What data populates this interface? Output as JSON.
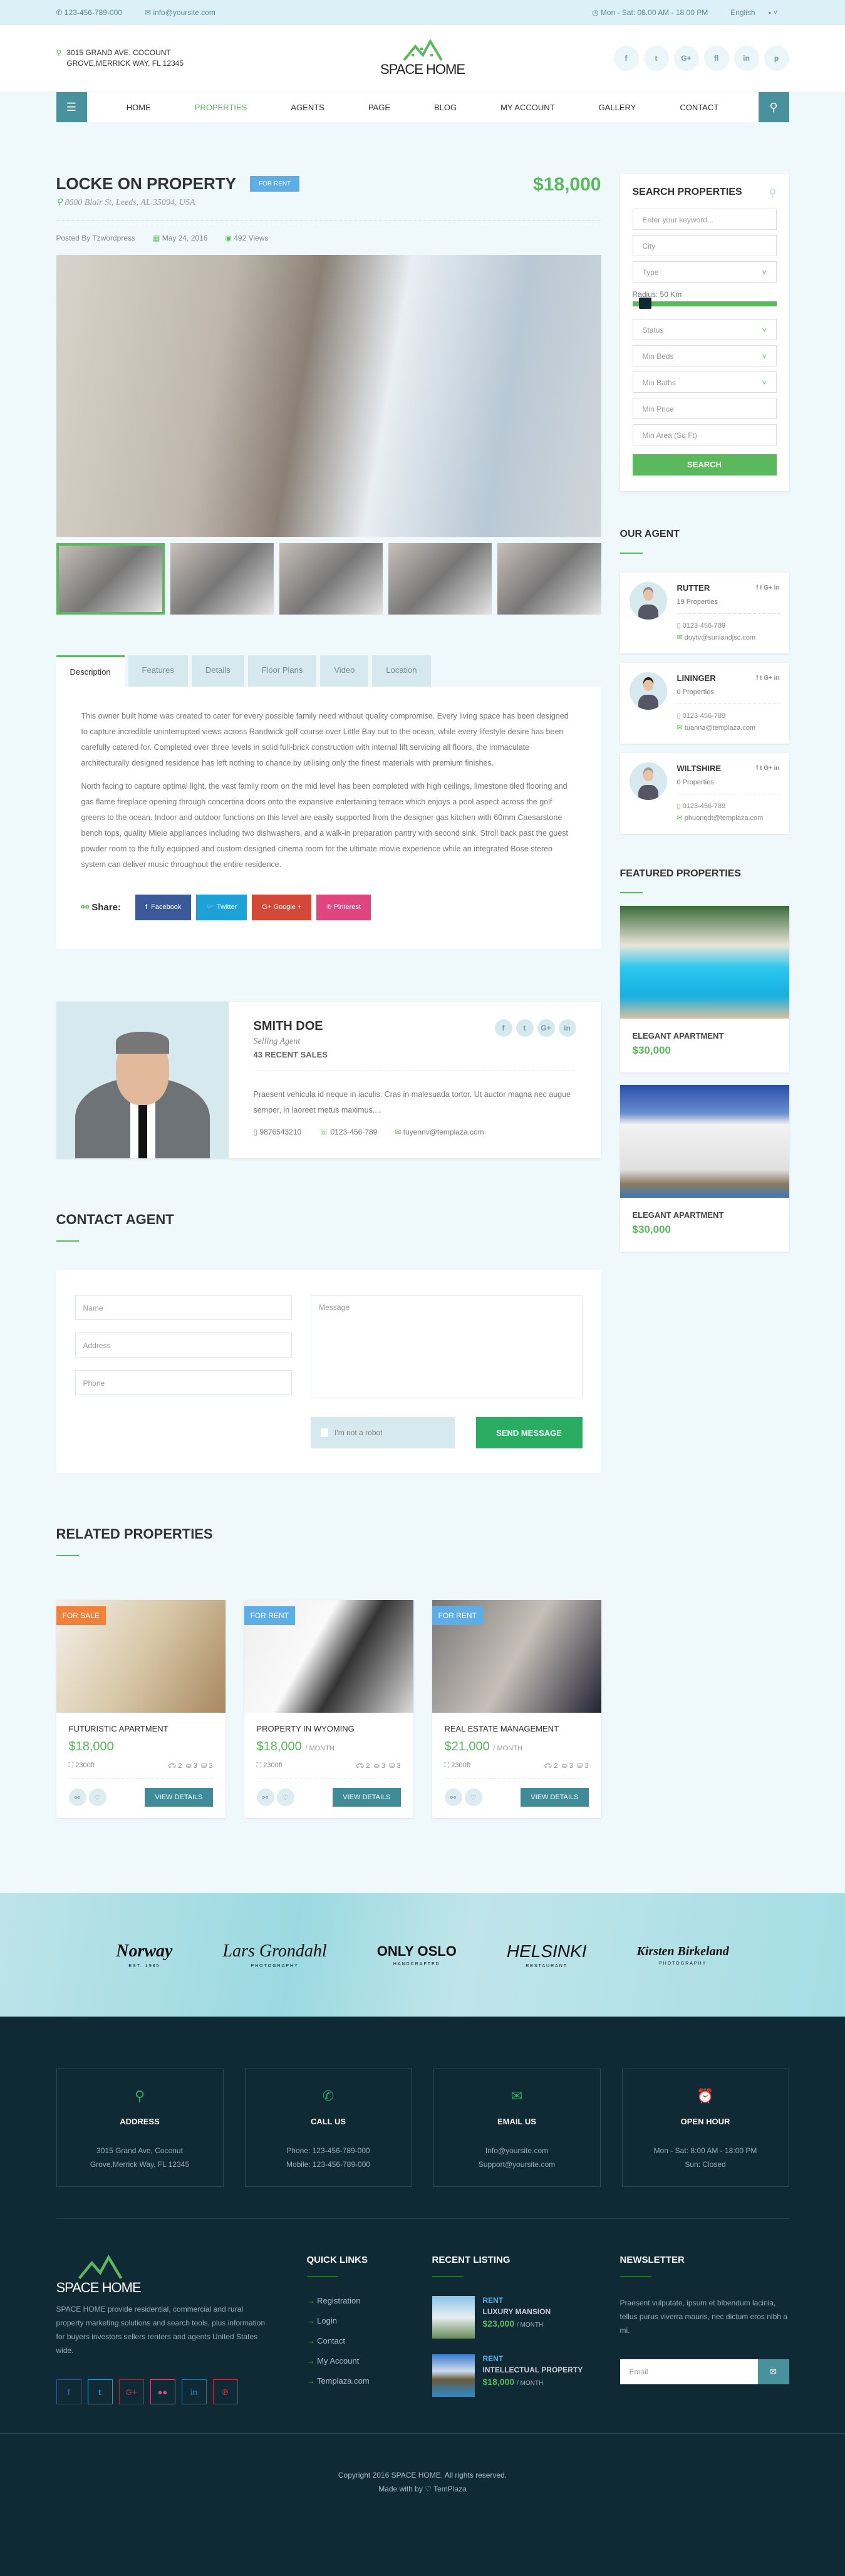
{
  "topbar": {
    "phone": "123-456-789-000",
    "email": "info@yoursite.com",
    "hours": "Mon - Sat: 08.00 AM - 18.00 PM",
    "language": "English"
  },
  "header": {
    "address_line1": "3015 GRAND AVE, COCOUNT",
    "address_line2": "GROVE,MERRICK WAY, FL 12345",
    "logo": "SPACE HOME",
    "socials": [
      "f",
      "t",
      "G+",
      "fl",
      "in",
      "p"
    ]
  },
  "nav": {
    "items": [
      "HOME",
      "PROPERTIES",
      "AGENTS",
      "PAGE",
      "BLOG",
      "MY ACCOUNT",
      "GALLERY",
      "CONTACT"
    ],
    "active": "PROPERTIES"
  },
  "property": {
    "title": "LOCKE ON PROPERTY",
    "badge": "FOR RENT",
    "price": "$18,000",
    "address": "8600 Blair St, Leeds, AL 35094, USA",
    "posted_by": "Posted By Tzwordpress",
    "date": "May 24, 2016",
    "views": "492 Views"
  },
  "tabs": [
    "Description",
    "Features",
    "Details",
    "Floor Plans",
    "Video",
    "Location"
  ],
  "description": [
    "This owner built home was created to cater for every possible family need without quality compromise. Every living space has been designed to capture incredible uninterrupted views across Randwick golf course over Little Bay out to the ocean, while every lifestyle desire has been carefully catered for. Completed over three levels in solid full-brick construction with internal lift servicing all floors, the immaculate architecturally designed residence has left nothing to chance by utilising only the finest materials with premium finishes.",
    "North facing to capture optimal light, the vast family room on the mid level has been completed with high ceilings, limestone tiled flooring and gas flame fireplace opening through concertina doors onto the expansive entertaining terrace which enjoys a pool aspect across the golf greens to the ocean. Indoor and outdoor functions on this level are easily supported from the designer gas kitchen with 60mm Caesarstone bench tops, quality Miele appliances including two dishwashers, and a walk-in preparation pantry with second sink. Stroll back past the guest powder room to the fully equipped and custom designed cinema room for the ultimate movie experience while an integrated Bose stereo system can deliver music throughout the entire residence."
  ],
  "share": {
    "label": "Share:",
    "buttons": [
      {
        "label": "Facebook",
        "color": "#3b5998"
      },
      {
        "label": "Twitter",
        "color": "#1da1d6"
      },
      {
        "label": "Google +",
        "color": "#d34836"
      },
      {
        "label": "Pinterest",
        "color": "#e1457f"
      }
    ]
  },
  "agent": {
    "name": "SMITH DOE",
    "role": "Selling Agent",
    "sales": "43 RECENT SALES",
    "bio": "Praesent vehicula id neque in iaculis. Cras in malesuada tortor. Ut auctor magna nec augue semper, in laoreet metus maximus....",
    "mobile": "9876543210",
    "phone": "0123-456-789",
    "email": "tuyennv@templaza.com",
    "socials": [
      "f",
      "t",
      "G+",
      "in"
    ]
  },
  "contact": {
    "title": "CONTACT AGENT",
    "name": "Name",
    "address": "Address",
    "phone": "Phone",
    "message": "Message",
    "robot": "I'm not a robot",
    "send": "SEND MESSAGE"
  },
  "related": {
    "title": "RELATED PROPERTIES",
    "items": [
      {
        "badge": "FOR SALE",
        "badge_color": "#f0813a",
        "title": "FUTURISTIC APARTMENT",
        "price": "$18,000",
        "period": "",
        "area": "2300ft",
        "garage": "2",
        "bath": "3",
        "bed": "3",
        "button": "VIEW DETAILS"
      },
      {
        "badge": "FOR RENT",
        "badge_color": "#5daee6",
        "title": "PROPERTY IN WYOMING",
        "price": "$18,000",
        "period": "/ MONTH",
        "area": "2300ft",
        "garage": "2",
        "bath": "3",
        "bed": "3",
        "button": "VIEW DETAILS"
      },
      {
        "badge": "FOR RENT",
        "badge_color": "#5daee6",
        "title": "REAL ESTATE MANAGEMENT",
        "price": "$21,000",
        "period": "/ MONTH",
        "area": "2300ft",
        "garage": "2",
        "bath": "3",
        "bed": "3",
        "button": "VIEW DETAILS"
      }
    ]
  },
  "search": {
    "title": "SEARCH PROPERTIES",
    "keyword": "Enter your keyword...",
    "city": "City",
    "type": "Type",
    "radius": "Radius: 50 Km",
    "radius_value_km": 50,
    "status": "Status",
    "min_beds": "Min Beds",
    "min_baths": "Min Baths",
    "min_price": "Min Price",
    "min_area": "Min Area (Sq Ft)",
    "button": "SEARCH"
  },
  "our_agent": {
    "title": "OUR AGENT",
    "items": [
      {
        "name": "RUTTER",
        "props": "19 Properties",
        "phone": "0123-456-789",
        "email": "duytv@sunlandjsc.com"
      },
      {
        "name": "LININGER",
        "props": "0 Properties",
        "phone": "0123-456-789",
        "email": "tuanna@templaza.com"
      },
      {
        "name": "WILTSHIRE",
        "props": "0 Properties",
        "phone": "0123-456-789",
        "email": "phuongdt@templaza.com"
      }
    ],
    "social_icons": "f t G+ in"
  },
  "featured": {
    "title": "FEATURED PROPERTIES",
    "items": [
      {
        "title": "ELEGANT APARTMENT",
        "price": "$30,000"
      },
      {
        "title": "ELEGANT APARTMENT",
        "price": "$30,000"
      }
    ]
  },
  "logos": [
    {
      "name": "Norway",
      "sub": "EST. 1985"
    },
    {
      "name": "Lars Grondahl",
      "sub": "PHOTOGRAPHY"
    },
    {
      "name": "ONLY OSLO",
      "sub": "HANDCRAFTED"
    },
    {
      "name": "HELSINKI",
      "sub": "RESTAURANT"
    },
    {
      "name": "Kirsten Birkeland",
      "sub": "PHOTOGRAPHY"
    }
  ],
  "footer": {
    "info": [
      {
        "title": "ADDRESS",
        "l1": "3015 Grand Ave, Coconut",
        "l2": "Grove,Merrick Way, FL 12345"
      },
      {
        "title": "CALL US",
        "l1": "Phone: 123-456-789-000",
        "l2": "Mobile: 123-456-789-000"
      },
      {
        "title": "EMAIL US",
        "l1": "Info@yoursite.com",
        "l2": "Support@yoursite.com"
      },
      {
        "title": "OPEN HOUR",
        "l1": "Mon - Sat: 8:00 AM - 18:00 PM",
        "l2": "Sun: Closed"
      }
    ],
    "about": "SPACE HOME provide residential, commercial and rural property marketing solutions and search tools, plus information for buyers investors sellers renters and agents United States wide.",
    "quick_links_title": "QUICK LINKS",
    "quick_links": [
      "Registration",
      "Login",
      "Contact",
      "My Account",
      "Templaza.com"
    ],
    "recent_title": "RECENT LISTING",
    "recent": [
      {
        "kind": "RENT",
        "name": "LUXURY MANSION",
        "price": "$23,000",
        "period": "/ MONTH"
      },
      {
        "kind": "RENT",
        "name": "INTELLECTUAL PROPERTY",
        "price": "$18,000",
        "period": "/ MONTH"
      }
    ],
    "newsletter_title": "NEWSLETTER",
    "newsletter_text": "Praesent vulputate, ipsum et bibendum lacinia, tellus purus viverra mauris, nec dictum eros nibh a mi.",
    "email_placeholder": "Email",
    "copyright": "Copyright 2016 SPACE HOME. All rights reserved.",
    "made_with": "Made with by ♡ TemPlaza"
  }
}
